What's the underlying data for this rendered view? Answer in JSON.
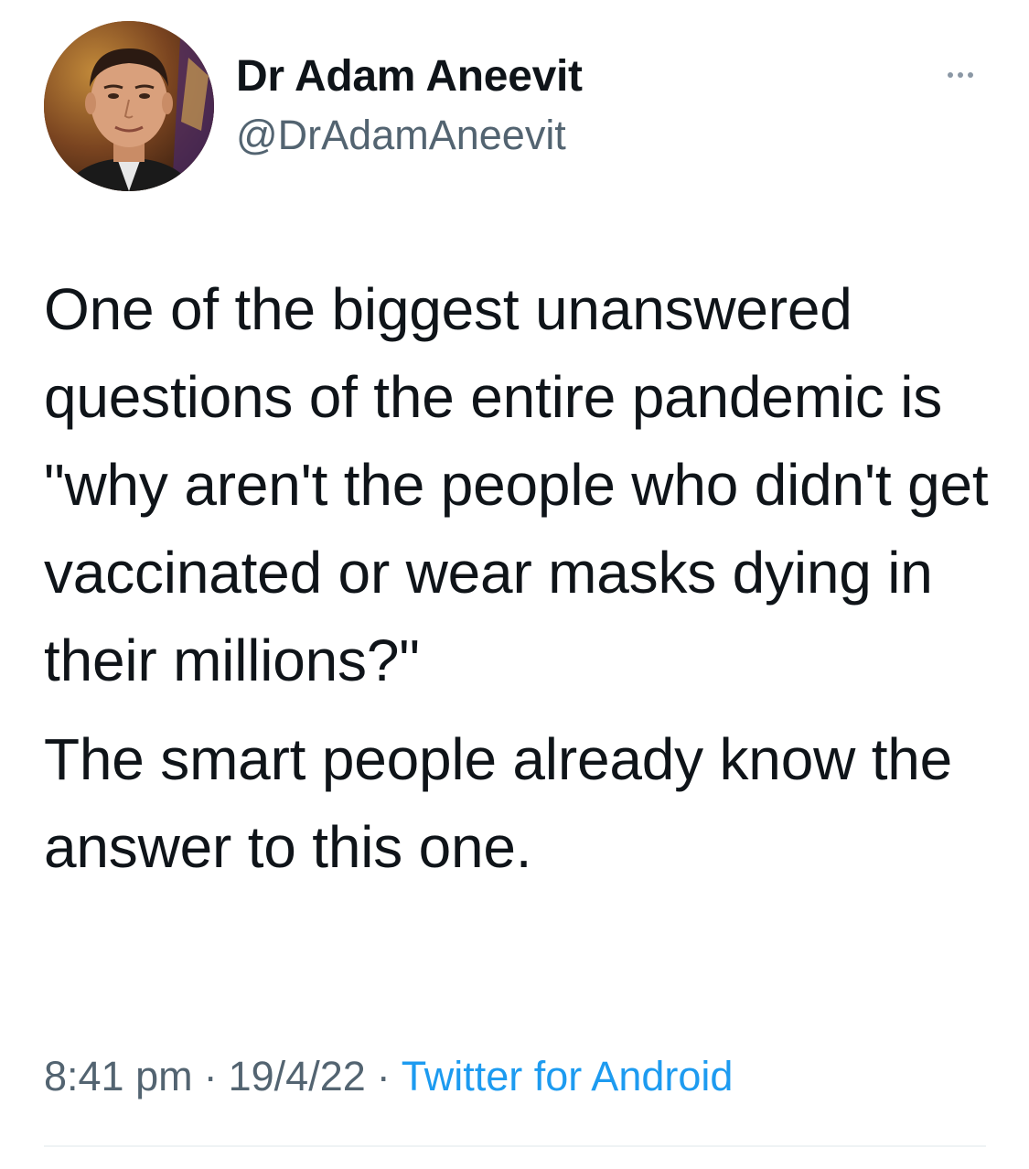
{
  "author": {
    "display_name": "Dr Adam Aneevit",
    "handle": "@DrAdamAneevit",
    "avatar_icon": "profile-photo"
  },
  "more_icon": "more-horizontal-icon",
  "tweet": {
    "paragraphs": [
      "One of the biggest unanswered questions of the entire pandemic is \"why aren't the people who didn't get vaccinated or wear masks dying in their millions?\"",
      "The smart people already know the answer to this one."
    ]
  },
  "meta": {
    "time": "8:41 pm",
    "separator": "·",
    "date": "19/4/22",
    "source": "Twitter for Android"
  },
  "colors": {
    "text": "#0f1419",
    "secondary": "#536471",
    "link": "#1d9bf0"
  }
}
